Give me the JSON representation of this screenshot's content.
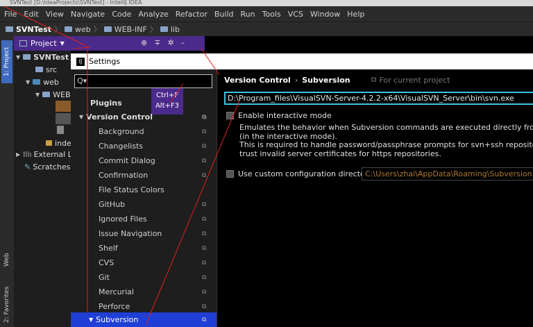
{
  "title_bar": "SVNTest [D:\\IdeaProjects\\SVNTest] - IntelliJ IDEA",
  "menu": [
    "File",
    "Edit",
    "View",
    "Navigate",
    "Code",
    "Analyze",
    "Refactor",
    "Build",
    "Run",
    "Tools",
    "VCS",
    "Window",
    "Help"
  ],
  "breadcrumb": [
    "SVNTest",
    "web",
    "WEB-INF",
    "lib"
  ],
  "stripe": {
    "project": "1: Project",
    "web": "Web",
    "favorites": "2: Favorites"
  },
  "project_panel": {
    "title": "Project"
  },
  "tree": {
    "svntest": "SVNTest",
    "src": "src",
    "web": "web",
    "webinf": "WEB",
    "index": "inde",
    "external": "External Li",
    "scratches": "Scratches"
  },
  "settings": {
    "title": "Settings",
    "search_value": "Q▾",
    "tooltip": [
      "Ctrl+F",
      "Alt+F3"
    ],
    "left_items": [
      "Plugins",
      "Version Control",
      "Background",
      "Changelists",
      "Commit Dialog",
      "Confirmation",
      "File Status Colors",
      "GitHub",
      "Ignored Files",
      "Issue Navigation",
      "Shelf",
      "CVS",
      "Git",
      "Mercurial",
      "Perforce",
      "Subversion"
    ],
    "header": {
      "section": "Version Control",
      "arrow": "›",
      "page": "Subversion",
      "scope": "For current project"
    },
    "svn_path": "D:\\Program_files\\VisualSVN-Server-4.2.2-x64\\VisualSVN_Server\\bin\\svn.exe",
    "interactive_label": "Enable interactive mode",
    "description": [
      "Emulates the behavior when Subversion commands are executed directly from the termi",
      "(in the interactive mode).",
      "This is required to handle password/passphrase prompts for svn+ssh repositories, and",
      "trust invalid server certificates for https repositories."
    ],
    "custom_cfg_label": "Use custom configuration directory:",
    "custom_cfg_value": "C:\\Users\\zhai\\AppData\\Roaming\\Subversion"
  },
  "colors": {
    "accent": "#3dc3df",
    "selection": "#1f3fd6",
    "panel_header": "#4a2a8a",
    "annotation": "#e02020"
  }
}
